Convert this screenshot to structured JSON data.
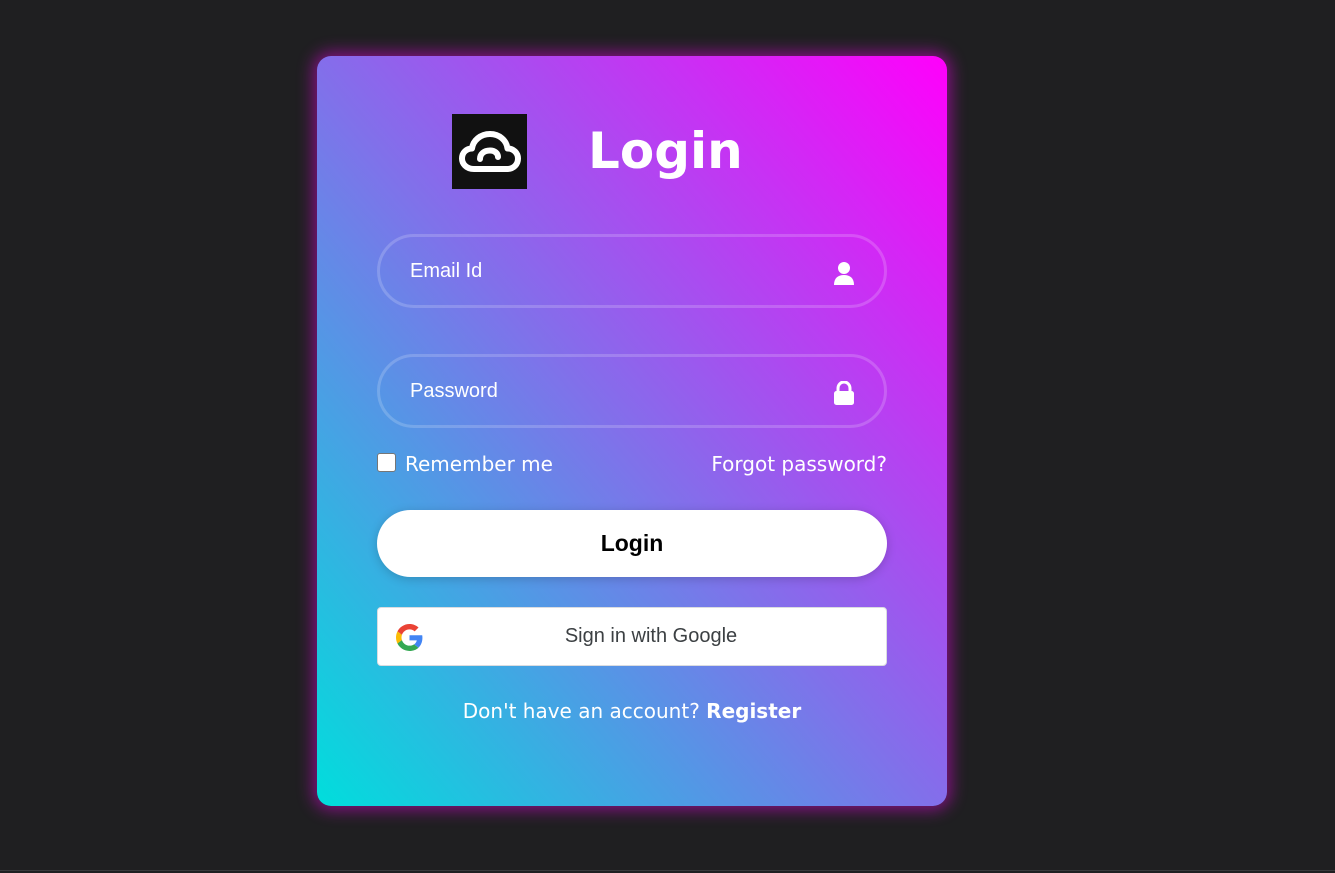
{
  "login_card": {
    "title": "Login",
    "logo_icon": "cloud-icon",
    "email": {
      "placeholder": "Email Id",
      "value": "",
      "icon": "user-icon"
    },
    "password": {
      "placeholder": "Password",
      "value": "",
      "icon": "lock-icon"
    },
    "remember_label": "Remember me",
    "remember_checked": false,
    "forgot_label": "Forgot password?",
    "login_button_label": "Login",
    "google_button_label": "Sign in with Google",
    "google_icon": "google-icon",
    "register_prompt": "Don't have an account?",
    "register_link_label": "Register"
  },
  "colors": {
    "background": "#1f1f21",
    "gradient_start": "#00dedc",
    "gradient_mid": "#7f72ea",
    "gradient_end": "#ff00fb",
    "text": "#ffffff"
  }
}
